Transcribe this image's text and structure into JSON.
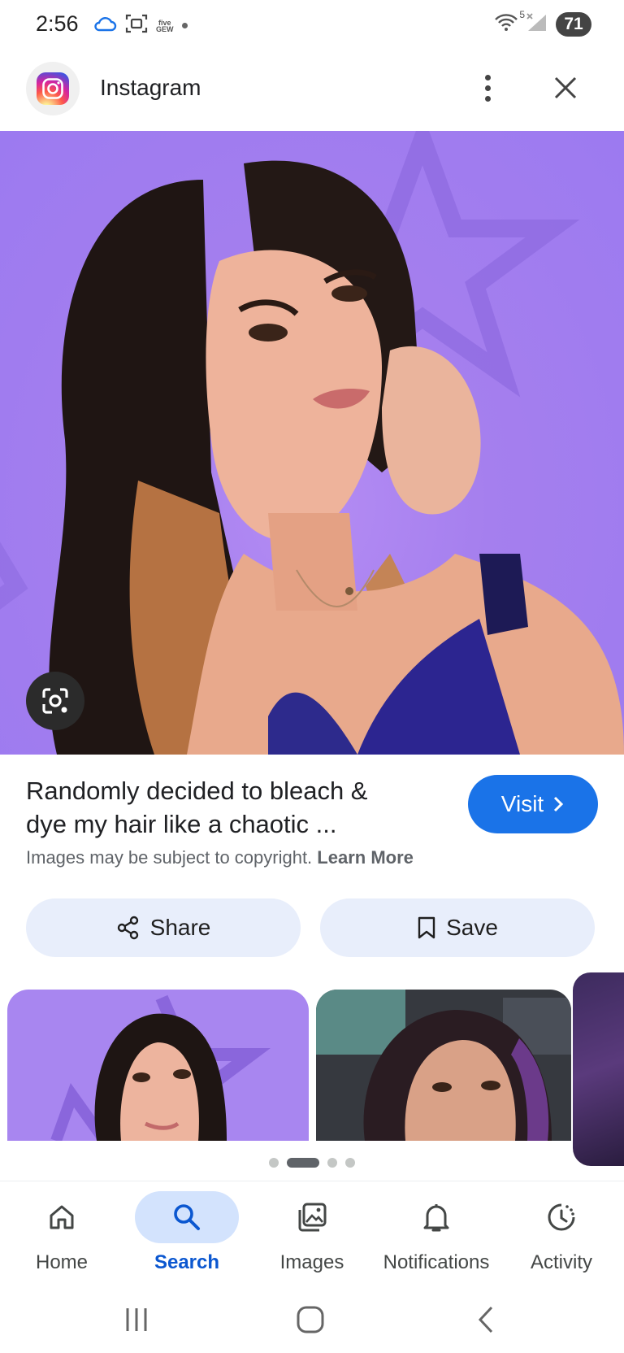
{
  "status_bar": {
    "time": "2:56",
    "left_icons": [
      "cloud-icon",
      "screenshot-icon",
      "five-gew-icon",
      "dot-icon"
    ],
    "five_gew_line1": "five",
    "five_gew_line2": "GEW",
    "wifi_superscript": "5",
    "battery": "71"
  },
  "header": {
    "app_name": "Instagram",
    "icons": [
      "instagram-logo",
      "more-vert-icon",
      "close-icon"
    ]
  },
  "result": {
    "title": "Randomly decided to bleach & dye my hair like a chaotic ...",
    "visit_label": "Visit",
    "copyright_text": "Images may be subject to copyright.",
    "learn_more": "Learn More"
  },
  "actions": {
    "share_label": "Share",
    "save_label": "Save"
  },
  "pager": {
    "count": 4,
    "active_index": 1
  },
  "bottom_nav": {
    "items": [
      {
        "label": "Home",
        "icon": "home-icon"
      },
      {
        "label": "Search",
        "icon": "search-icon",
        "active": true
      },
      {
        "label": "Images",
        "icon": "images-icon"
      },
      {
        "label": "Notifications",
        "icon": "bell-icon"
      },
      {
        "label": "Activity",
        "icon": "activity-icon"
      }
    ]
  },
  "system_nav": [
    "recent-apps-icon",
    "home-circle-icon",
    "back-icon"
  ],
  "colors": {
    "accent_blue": "#1a73e8",
    "nav_active_bg": "#d3e3fd",
    "nav_active_text": "#0b57d0",
    "action_button_bg": "#e8eefb",
    "hero_background": "#a57fee"
  }
}
